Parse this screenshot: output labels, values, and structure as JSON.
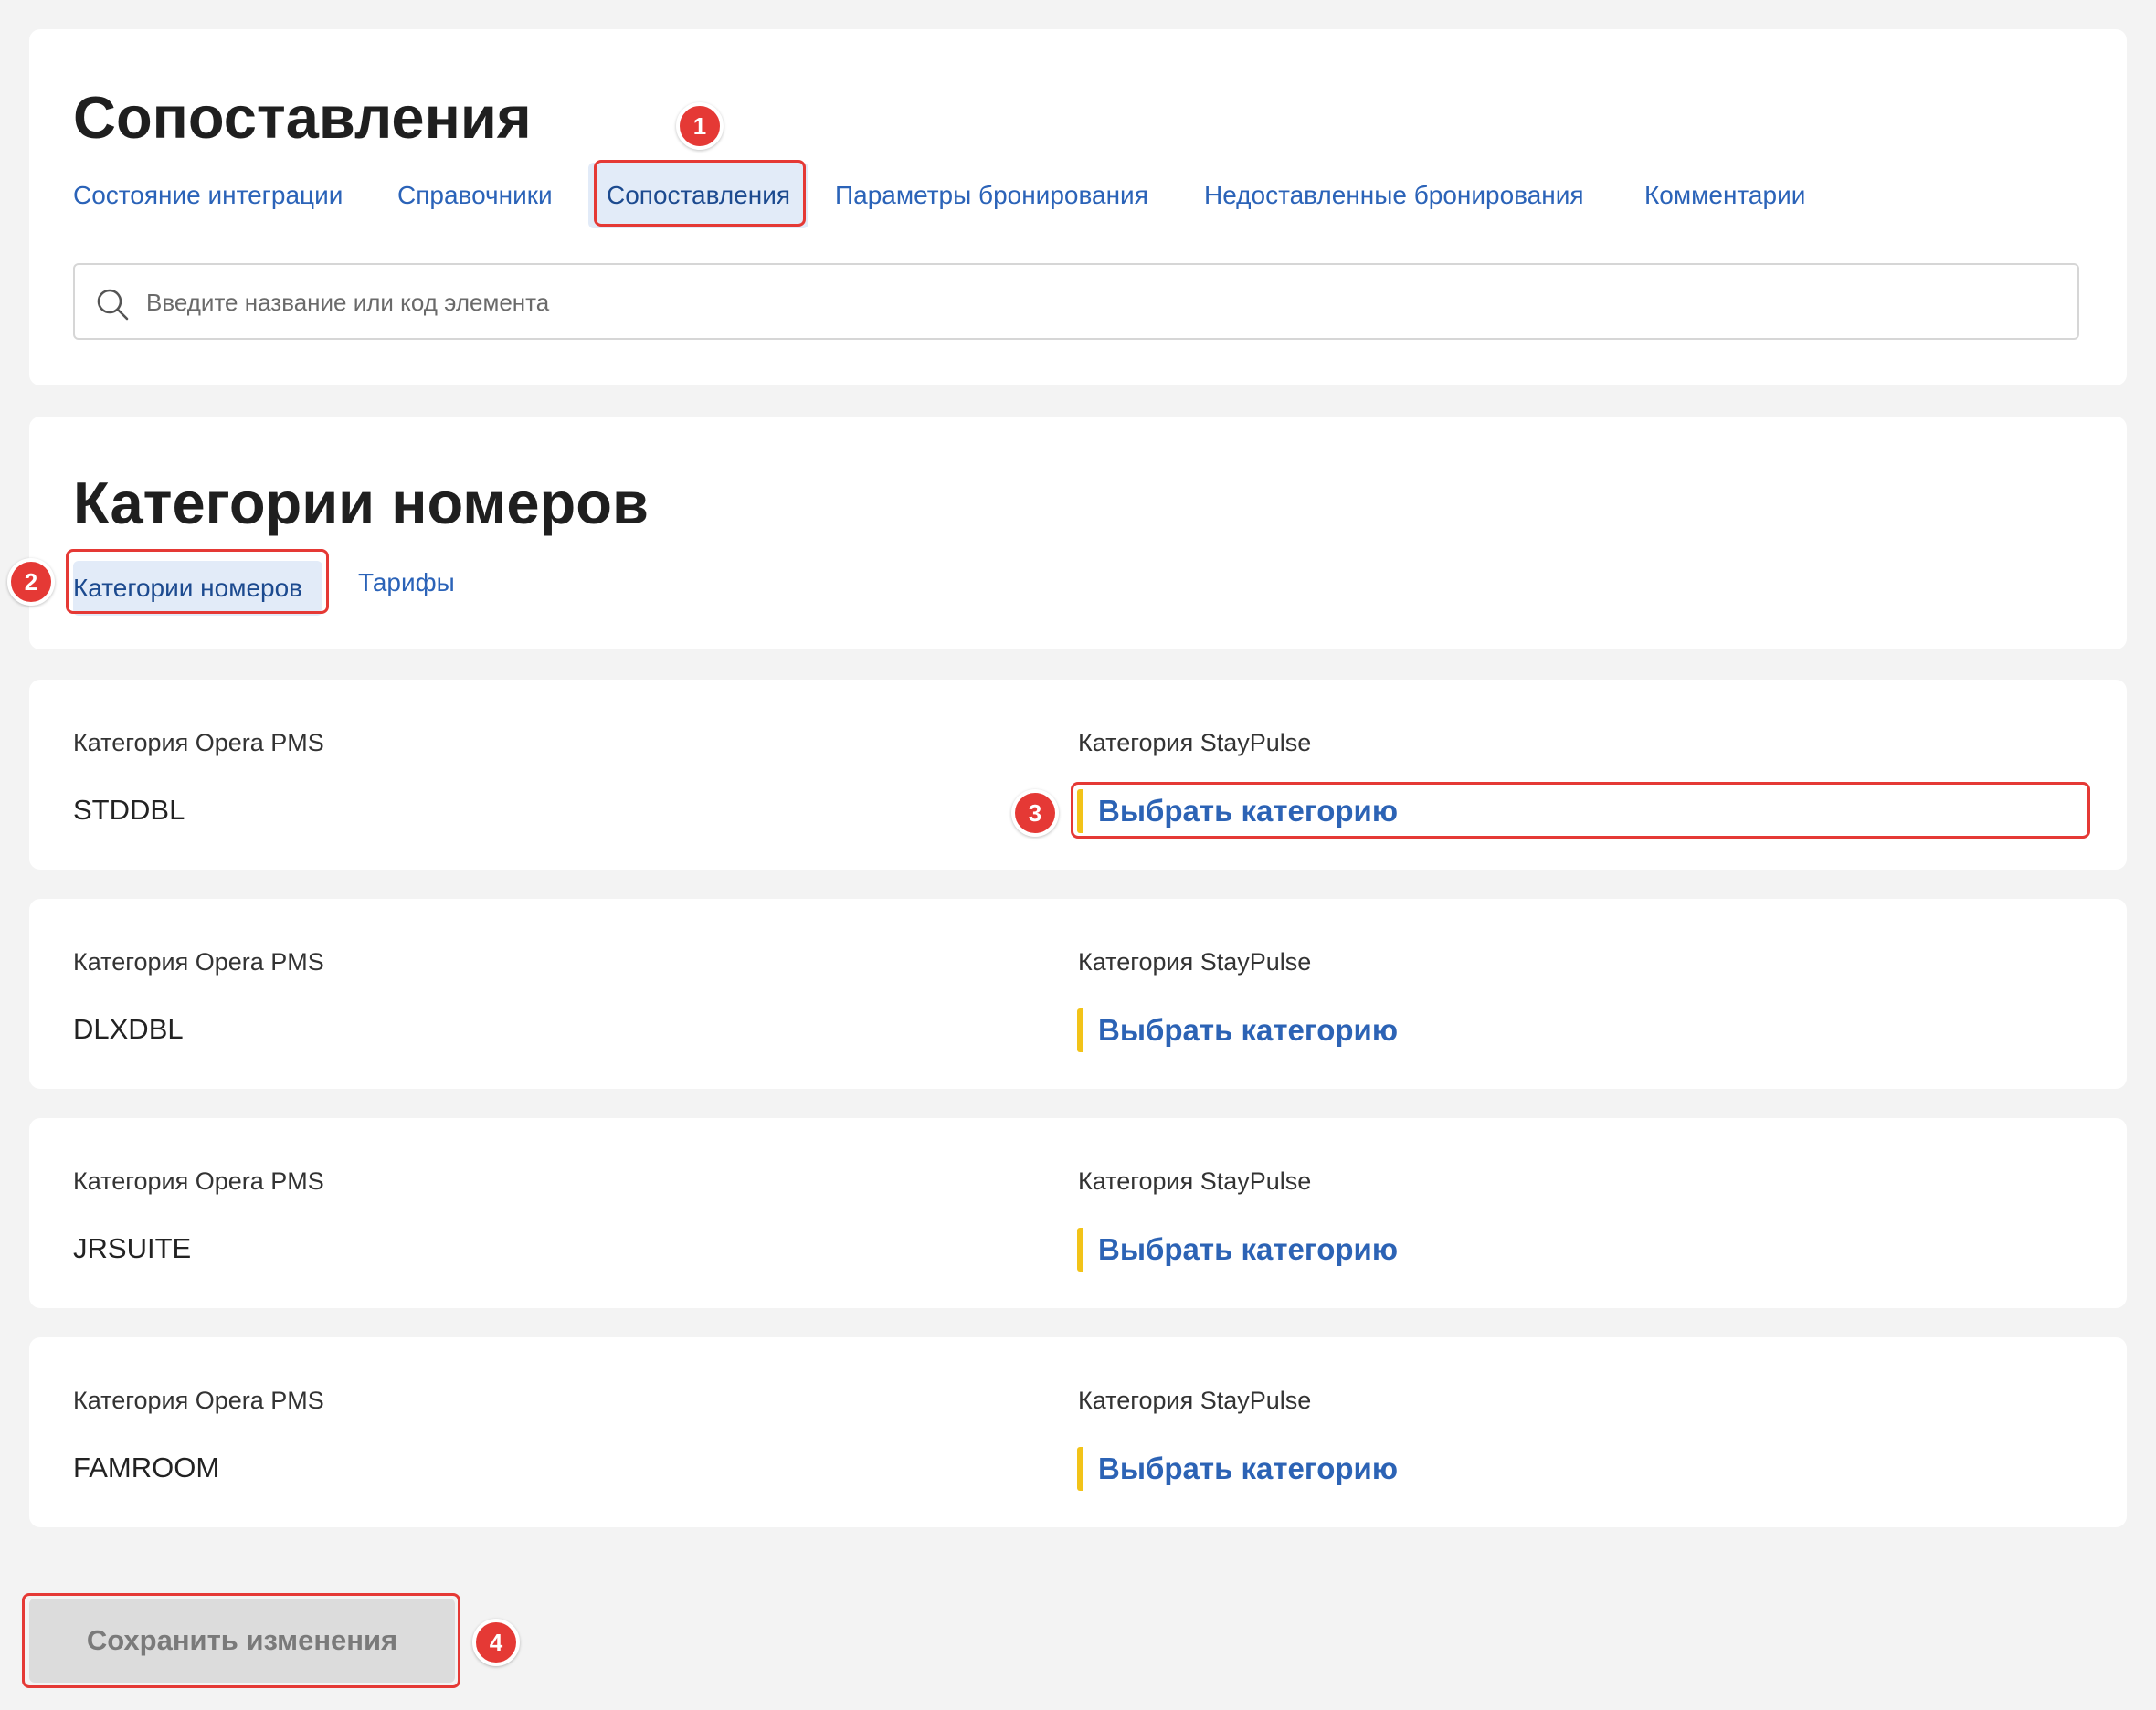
{
  "header": {
    "title": "Сопоставления",
    "tabs": [
      {
        "label": "Состояние интеграции"
      },
      {
        "label": "Справочники"
      },
      {
        "label": "Сопоставления"
      },
      {
        "label": "Параметры бронирования"
      },
      {
        "label": "Недоставленные бронирования"
      },
      {
        "label": "Комментарии"
      }
    ],
    "active_tab": "Сопоставления",
    "search": {
      "placeholder": "Введите название или код элемента",
      "value": "",
      "icon": "search-icon"
    }
  },
  "section": {
    "title": "Категории номеров",
    "subtabs": [
      {
        "label": "Категории номеров"
      },
      {
        "label": "Тарифы"
      }
    ],
    "active_subtab": "Категории номеров"
  },
  "mappings": [
    {
      "source_label": "Категория Opera PMS",
      "source_code": "STDDBL",
      "target_label": "Категория StayPulse",
      "target_action": "Выбрать категорию"
    },
    {
      "source_label": "Категория Opera PMS",
      "source_code": "DLXDBL",
      "target_label": "Категория StayPulse",
      "target_action": "Выбрать категорию"
    },
    {
      "source_label": "Категория Opera PMS",
      "source_code": "JRSUITE",
      "target_label": "Категория StayPulse",
      "target_action": "Выбрать категорию"
    },
    {
      "source_label": "Категория Opera PMS",
      "source_code": "FAMROOM",
      "target_label": "Категория StayPulse",
      "target_action": "Выбрать категорию"
    }
  ],
  "footer": {
    "save_label": "Сохранить изменения"
  },
  "annotations": [
    {
      "number": "1"
    },
    {
      "number": "2"
    },
    {
      "number": "3"
    },
    {
      "number": "4"
    }
  ],
  "colors": {
    "accent": "#2b63b8",
    "annotation": "#e53935",
    "marker": "#f2c318",
    "background": "#f3f3f3"
  }
}
